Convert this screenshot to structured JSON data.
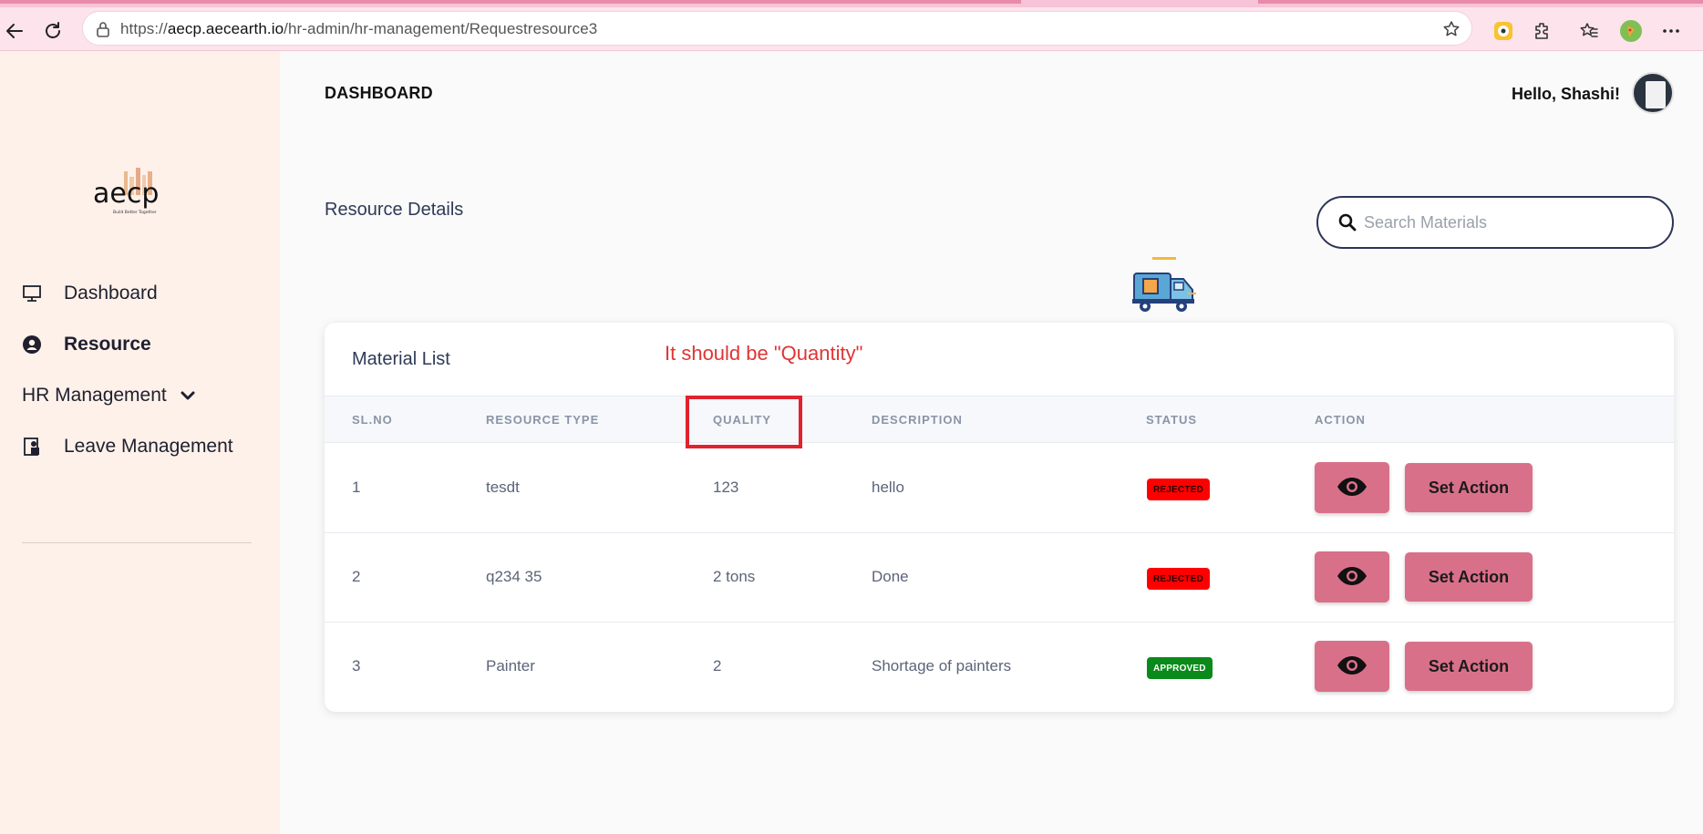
{
  "browser": {
    "url_prefix": "https://",
    "url_host": "aecp.aecearth.io",
    "url_path": "/hr-admin/hr-management/Requestresource3"
  },
  "sidebar": {
    "logo_text": "aecp",
    "logo_tagline": "Build Better Together",
    "items": [
      {
        "label": "Dashboard",
        "icon": "monitor-icon",
        "active": false
      },
      {
        "label": "Resource",
        "icon": "user-circle-icon",
        "active": true
      },
      {
        "label": "HR Management",
        "icon": "chevron-down-icon",
        "active": false
      },
      {
        "label": "Leave Management",
        "icon": "leave-icon",
        "active": false
      }
    ]
  },
  "header": {
    "title": "DASHBOARD",
    "greeting": "Hello, Shashi!"
  },
  "page": {
    "section_title": "Resource Details",
    "search_placeholder": "Search Materials"
  },
  "table": {
    "title": "Material List",
    "columns": [
      "SL.NO",
      "RESOURCE TYPE",
      "QUALITY",
      "DESCRIPTION",
      "STATUS",
      "ACTION"
    ],
    "rows": [
      {
        "sl": "1",
        "type": "tesdt",
        "quality": "123",
        "description": "hello",
        "status": "REJECTED",
        "action": "Set Action"
      },
      {
        "sl": "2",
        "type": "q234 35",
        "quality": "2 tons",
        "description": "Done",
        "status": "REJECTED",
        "action": "Set Action"
      },
      {
        "sl": "3",
        "type": "Painter",
        "quality": "2",
        "description": "Shortage of painters",
        "status": "APPROVED",
        "action": "Set Action"
      }
    ]
  },
  "annotation": {
    "text": "It should be \"Quantity\""
  },
  "colors": {
    "accent_button": "#d97089",
    "rejected": "#ff0000",
    "approved": "#0a8a1a",
    "sidebar_bg": "#fdf1ea",
    "annotation": "#e0232e"
  }
}
